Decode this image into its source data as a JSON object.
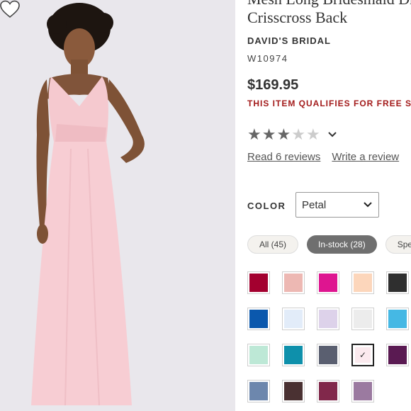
{
  "product": {
    "title_lines": [
      "Mesh Long Bridesmaid Dress with",
      "Crisscross Back"
    ],
    "brand": "DAVID'S BRIDAL",
    "sku": "W10974",
    "price": "$169.95",
    "shipping_note": "THIS ITEM QUALIFIES FOR FREE SHIPPING"
  },
  "rating": {
    "stars_filled": 3,
    "stars_total": 5
  },
  "reviews": {
    "read_label": "Read 6 reviews",
    "write_label": "Write a review"
  },
  "color": {
    "label": "COLOR",
    "selected": "Petal",
    "filters": [
      "All (45)",
      "In-stock (28)",
      "Special Order"
    ],
    "active_filter": "In-stock (28)",
    "swatches": [
      {
        "name": "wine",
        "hex": "#a3002f"
      },
      {
        "name": "blush",
        "hex": "#edb8b3"
      },
      {
        "name": "fuchsia",
        "hex": "#de1590"
      },
      {
        "name": "peach",
        "hex": "#fcd6bb"
      },
      {
        "name": "black",
        "hex": "#2f2f2f"
      },
      {
        "name": "royal",
        "hex": "#0b58ad"
      },
      {
        "name": "ice-blue",
        "hex": "#e2ecf9"
      },
      {
        "name": "lilac",
        "hex": "#ddd2ea"
      },
      {
        "name": "ivory-grey",
        "hex": "#ececec"
      },
      {
        "name": "pool",
        "hex": "#45b8e4"
      },
      {
        "name": "mint",
        "hex": "#bde8d6"
      },
      {
        "name": "oasis",
        "hex": "#0e90ab"
      },
      {
        "name": "pewter",
        "hex": "#5a5f70"
      },
      {
        "name": "petal",
        "hex": "#fbeaee",
        "selected": true
      },
      {
        "name": "plum",
        "hex": "#5a1a52"
      },
      {
        "name": "dusk-blue",
        "hex": "#6d87ad"
      },
      {
        "name": "truffle",
        "hex": "#4a3132"
      },
      {
        "name": "sangria",
        "hex": "#81284b"
      },
      {
        "name": "victorian-lilac",
        "hex": "#9b7aa0"
      }
    ]
  }
}
